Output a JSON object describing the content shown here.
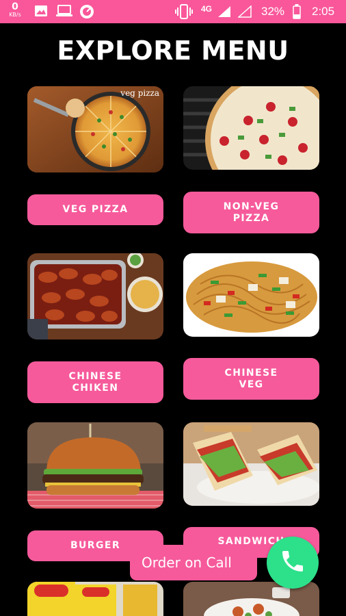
{
  "status_bar": {
    "net_speed": "0",
    "net_unit": "KB/s",
    "network": "4G",
    "battery": "32%",
    "time": "2:05",
    "icons": [
      "image-icon",
      "laptop-icon",
      "speedometer-icon",
      "vibrate-icon",
      "signal-icon",
      "signal-empty-icon",
      "battery-icon"
    ]
  },
  "page": {
    "title": "EXPLORE MENU"
  },
  "menu": {
    "items": [
      {
        "label": "VEG PIZZA",
        "photo_caption": "veg pizza"
      },
      {
        "label": "NON-VEG\nPIZZA"
      },
      {
        "label": "CHINESE\nCHIKEN"
      },
      {
        "label": "CHINESE\nVEG"
      },
      {
        "label": "BURGER"
      },
      {
        "label": "SANDWICH"
      }
    ]
  },
  "order": {
    "label": "Order on Call",
    "fab_icon": "phone-icon"
  },
  "colors": {
    "accent": "#f65a9b",
    "status_bar": "#f9579a",
    "call_button": "#2de08a",
    "background": "#000000"
  }
}
